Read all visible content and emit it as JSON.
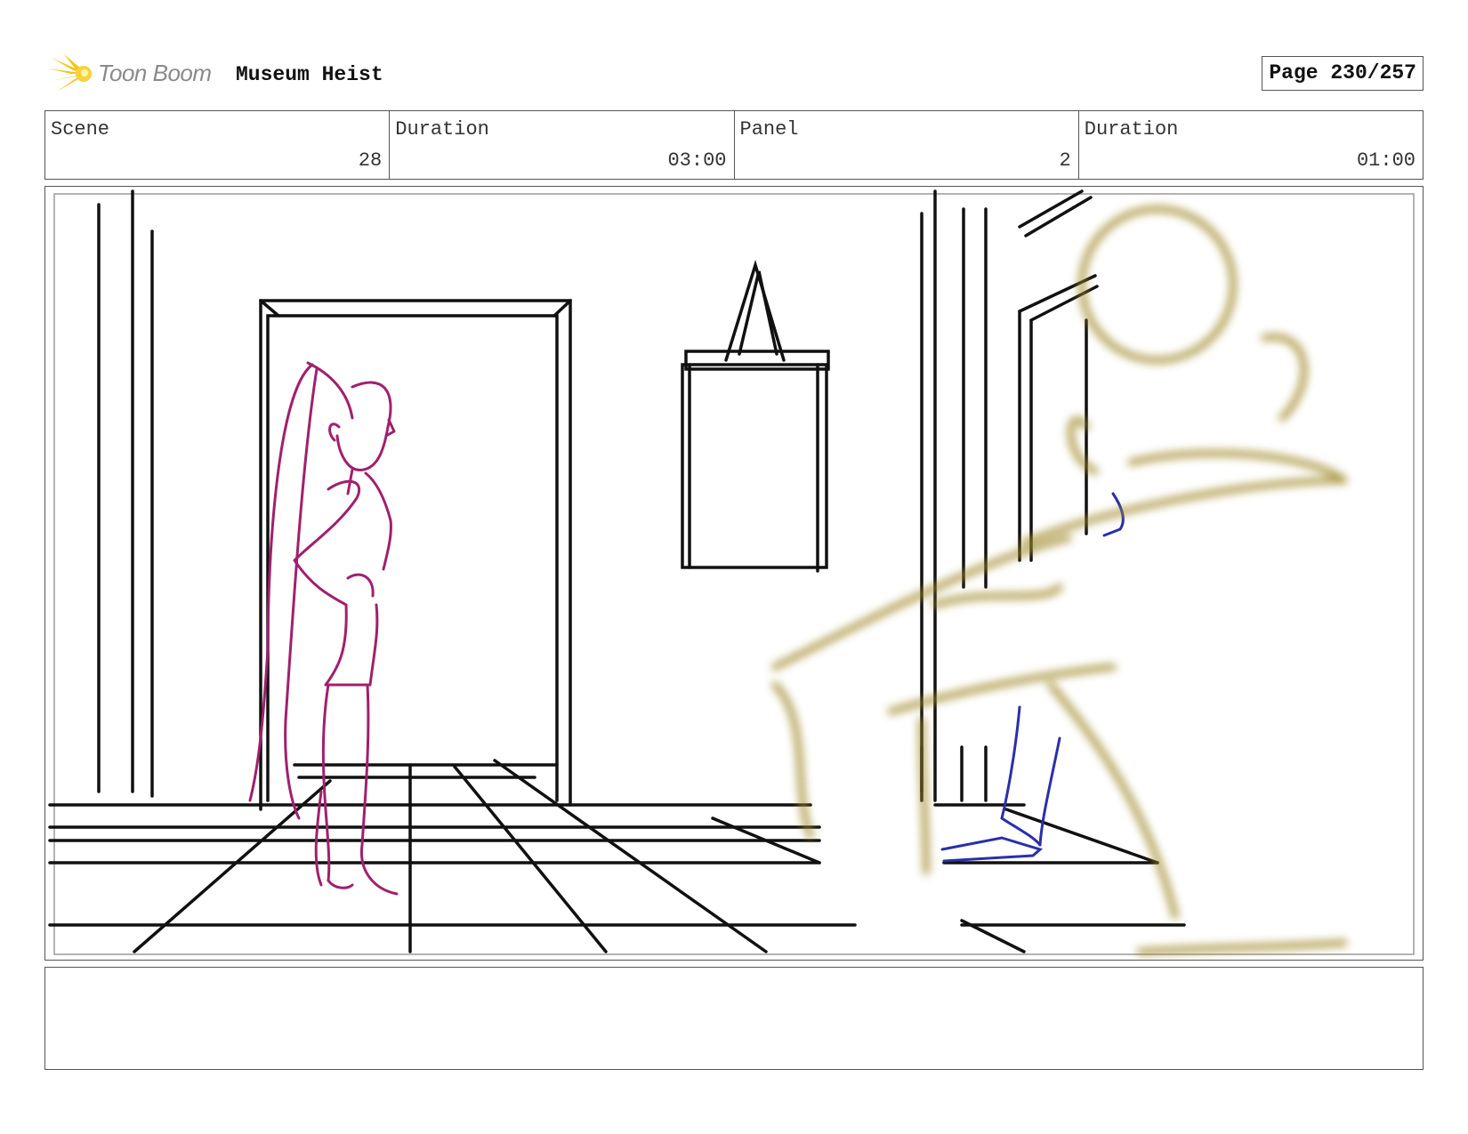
{
  "header": {
    "logo_text": "Toon Boom",
    "project_title": "Museum Heist",
    "page_label": "Page 230/257"
  },
  "info": {
    "scene_label": "Scene",
    "scene_value": "28",
    "scene_duration_label": "Duration",
    "scene_duration_value": "03:00",
    "panel_label": "Panel",
    "panel_value": "2",
    "panel_duration_label": "Duration",
    "panel_duration_value": "01:00"
  },
  "colors": {
    "logo_accent": "#f5c518",
    "sketch_line": "#111111",
    "character_magenta": "#a0206e",
    "character_blue": "#2a2fa8",
    "foreground_olive": "#a08a2a"
  },
  "notes": ""
}
